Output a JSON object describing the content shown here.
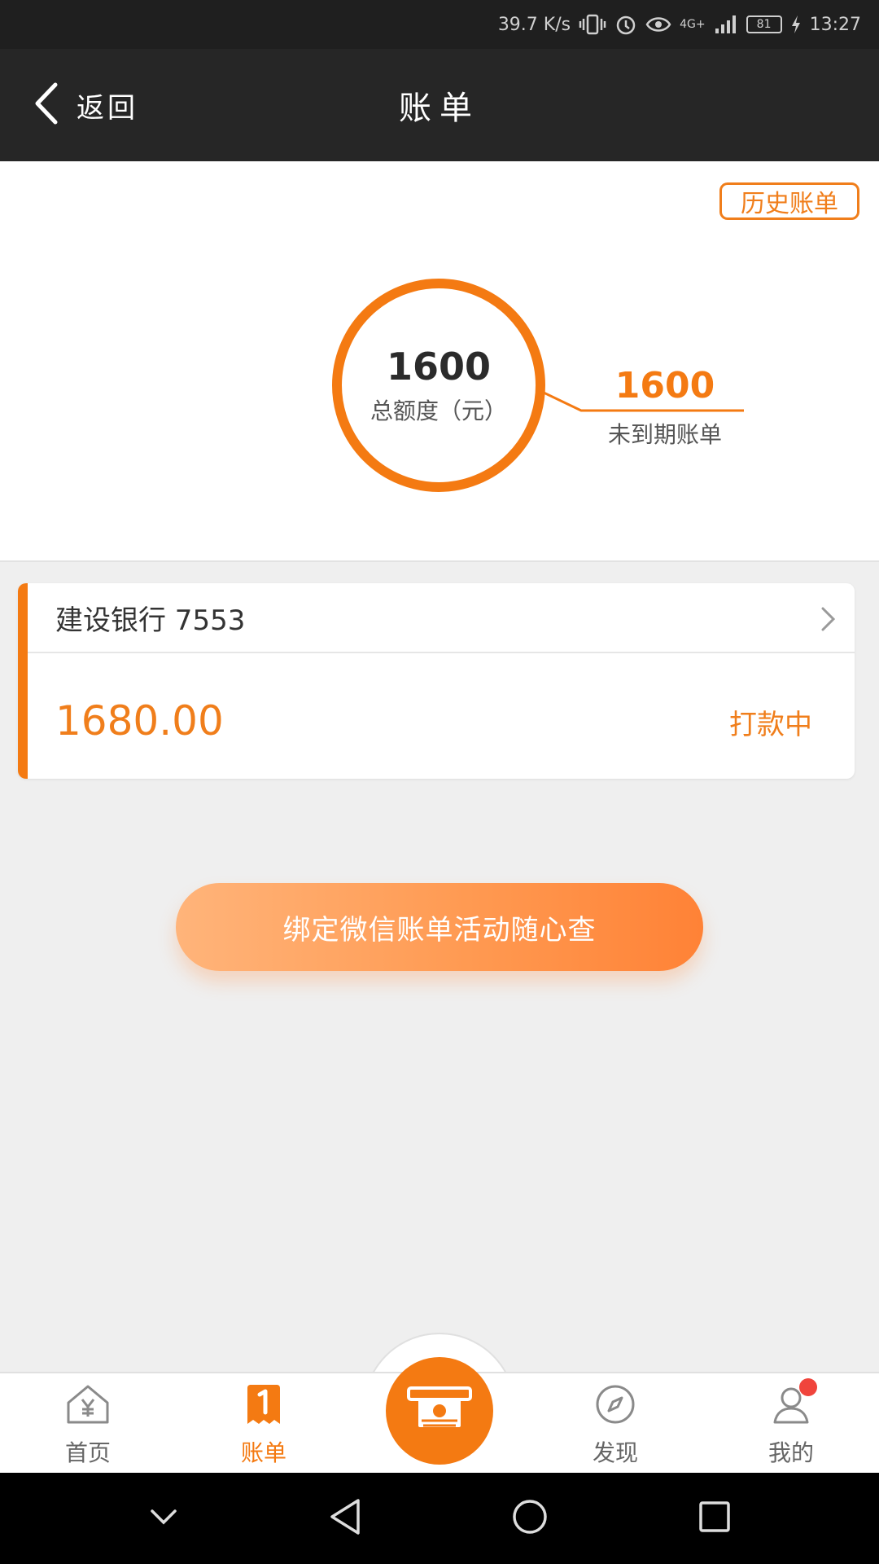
{
  "status_bar": {
    "speed": "39.7 K/s",
    "network": "4G+",
    "battery": "81",
    "time": "13:27"
  },
  "header": {
    "back_label": "返回",
    "title": "账单"
  },
  "summary": {
    "history_label": "历史账单",
    "total_value": "1600",
    "total_label": "总额度（元）",
    "pending_value": "1600",
    "pending_label": "未到期账单",
    "accent_color": "#f47a12"
  },
  "card": {
    "bank": "建设银行 7553",
    "amount": "1680.00",
    "status": "打款中"
  },
  "bind_button": {
    "label": "绑定微信账单活动随心查"
  },
  "tab_bar": {
    "items": [
      {
        "label": "首页",
        "icon": "home-yuan-icon"
      },
      {
        "label": "账单",
        "icon": "bill-icon",
        "active": true
      },
      {
        "label": "发现",
        "icon": "compass-icon"
      },
      {
        "label": "我的",
        "icon": "user-icon"
      }
    ],
    "center_icon": "cash-withdraw-icon"
  },
  "nav_bar": {
    "icons": [
      "chevron-down-icon",
      "back-triangle-icon",
      "home-circle-icon",
      "recents-square-icon"
    ]
  }
}
